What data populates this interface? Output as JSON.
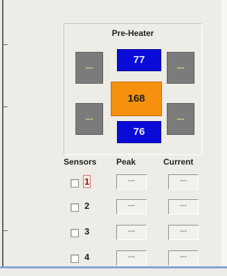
{
  "preheater": {
    "title": "Pre-Heater",
    "top_value": "77",
    "bottom_value": "76",
    "center_value": "168",
    "corner_placeholder": "---"
  },
  "sensors_table": {
    "headers": {
      "sensors": "Sensors",
      "peak": "Peak",
      "current": "Current"
    },
    "rows": [
      {
        "number": "1",
        "peak": "---",
        "current": "---"
      },
      {
        "number": "2",
        "peak": "---",
        "current": "---"
      },
      {
        "number": "3",
        "peak": "---",
        "current": "---"
      },
      {
        "number": "4",
        "peak": "---",
        "current": "---"
      }
    ]
  },
  "colors": {
    "blue_readout": "#0b0bd8",
    "orange_readout": "#f5910f",
    "gray_indicator": "#7b7b7b"
  }
}
